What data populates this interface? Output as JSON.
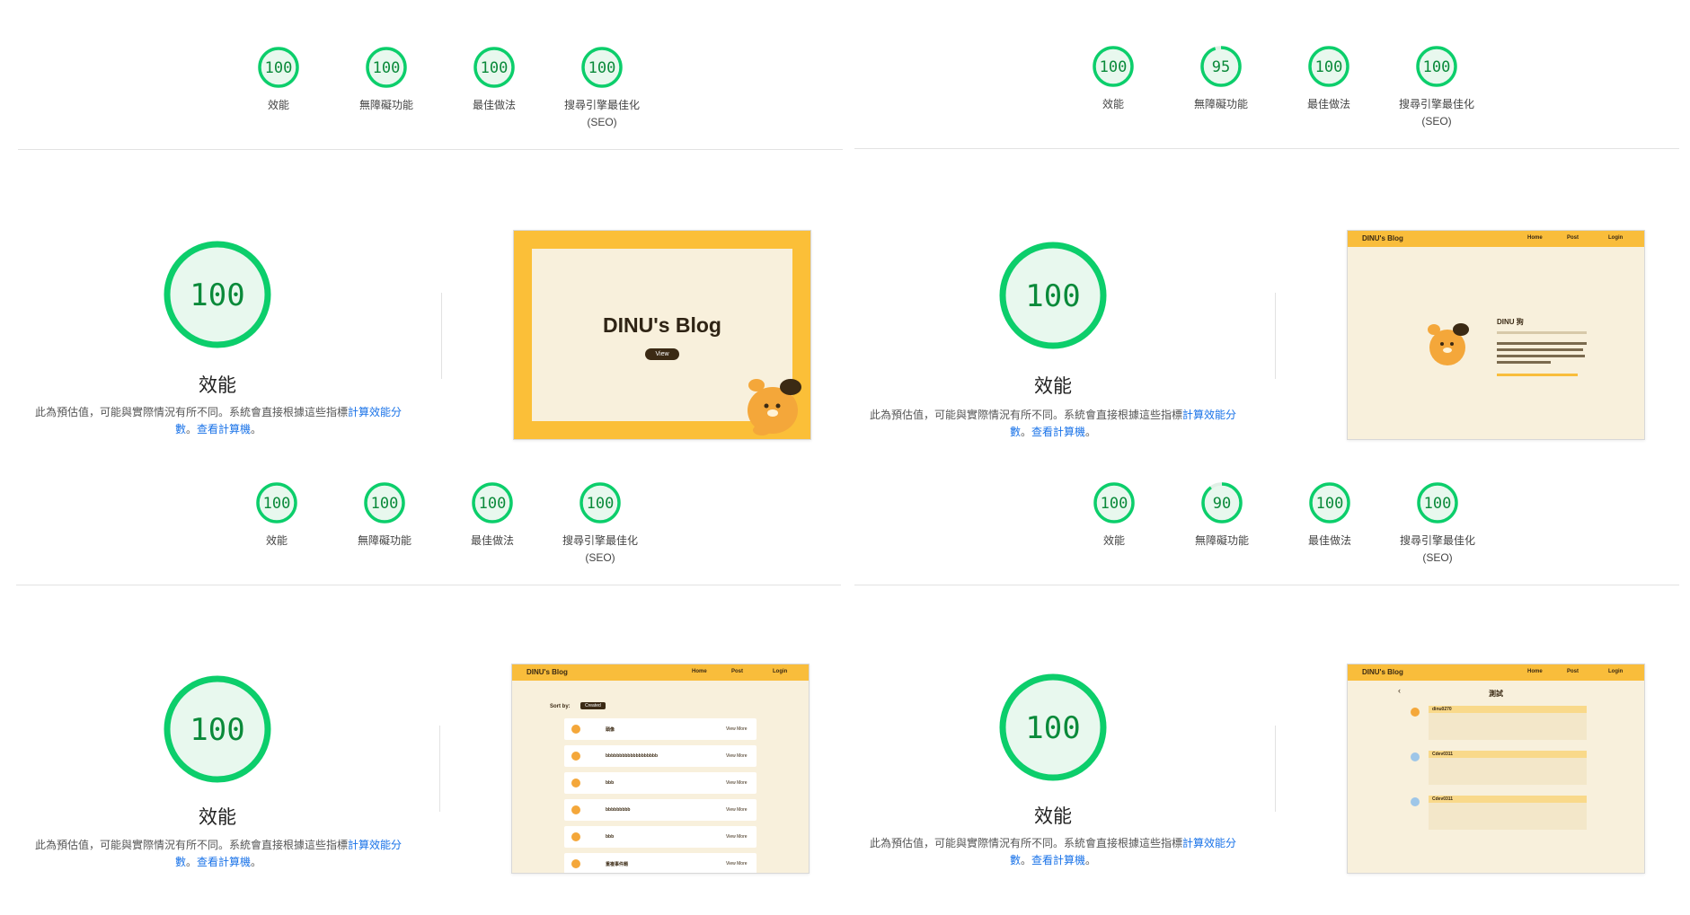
{
  "colors": {
    "pass_green": "#0cce6b",
    "pass_fill": "#e8f8ee",
    "text_green": "#0a8a3a",
    "link": "#1a73e8",
    "brand_yellow": "#f9bd3b",
    "cream": "#f8f0dc",
    "brown": "#3b2a14"
  },
  "labels": {
    "performance": "效能",
    "accessibility": "無障礙功能",
    "best_practices": "最佳做法",
    "seo": "搜尋引擎最佳化",
    "seo_abbr": "(SEO)",
    "big_title": "效能",
    "note_text": "此為預估值，可能與實際情況有所不同。系統會直接根據這些指標",
    "note_link1": "計算效能分數",
    "note_sep": "。",
    "note_link2": "查看計算機",
    "note_end": "。"
  },
  "panels": [
    {
      "top_scores": [
        100,
        100,
        100,
        100
      ],
      "big_score_1": 100,
      "mid_scores": [
        100,
        100,
        100,
        100
      ],
      "big_score_2": 100,
      "thumb1": {
        "title": "DINU's Blog",
        "button": "View"
      },
      "thumb2": {
        "brand": "DINU's Blog",
        "nav": [
          "Home",
          "Post",
          "Login"
        ],
        "sort_label": "Sort by:",
        "sort_value": "Created",
        "view_more": "View More",
        "rows": [
          "頭像",
          "bbbbbbbbbbbbbbbbbbb",
          "bbb",
          "bbbbbbbbb",
          "bbb",
          "重複事件題"
        ]
      }
    },
    {
      "top_scores": [
        100,
        95,
        100,
        100
      ],
      "big_score_1": 100,
      "mid_scores": [
        100,
        90,
        100,
        100
      ],
      "big_score_2": 100,
      "thumb1": {
        "brand": "DINU's Blog",
        "nav": [
          "Home",
          "Post",
          "Login"
        ],
        "name": "DINU 狗"
      },
      "thumb2": {
        "brand": "DINU's Blog",
        "nav": [
          "Home",
          "Post",
          "Login"
        ],
        "title": "測試",
        "back": "‹",
        "commenters": [
          "dinu0270",
          "Cdev0311",
          "Cdev0311"
        ]
      }
    }
  ]
}
